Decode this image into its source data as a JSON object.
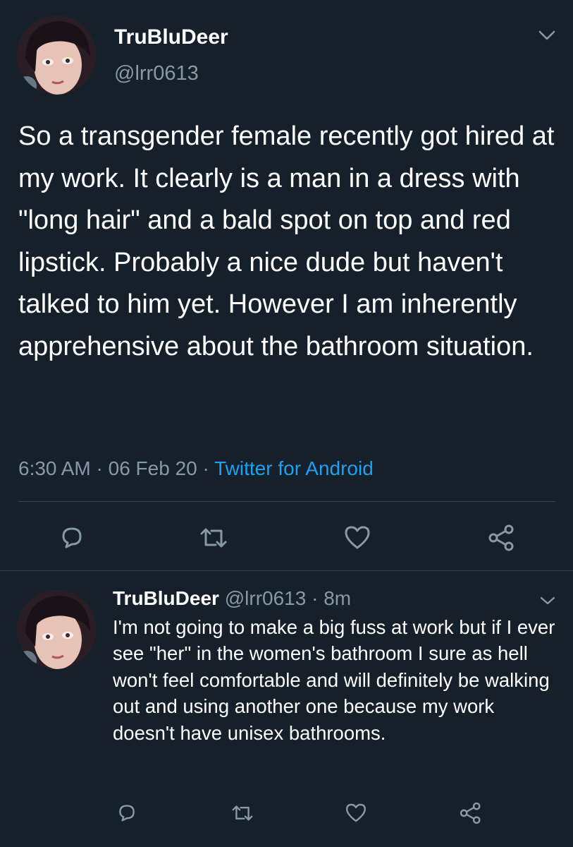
{
  "main_tweet": {
    "display_name": "TruBluDeer",
    "handle": "@lrr0613",
    "text": "So a transgender female recently got hired at my work. It clearly is a man in a dress with \"long hair\" and a bald spot on top and red lipstick. Probably a nice dude but haven't talked to him yet. However I am inherently apprehensive about the bathroom situation.",
    "time": "6:30 AM",
    "sep1": "·",
    "date": "06 Feb 20",
    "sep2": "·",
    "source": "Twitter for Android"
  },
  "reply_tweet": {
    "display_name": "TruBluDeer",
    "handle": "@lrr0613",
    "sep": "·",
    "age": "8m",
    "text": "I'm not going to make a big fuss at work but if I ever see \"her\" in the women's bathroom I sure as hell won't feel comfortable and will definitely be walking out and using another one because my work doesn't have unisex bathrooms."
  },
  "icons": {
    "reply": "reply-icon",
    "retweet": "retweet-icon",
    "like": "like-icon",
    "share": "share-icon",
    "chevron": "chevron-down-icon"
  },
  "colors": {
    "background": "#15202b",
    "text": "#ffffff",
    "muted": "#8899a6",
    "link": "#1da1f2",
    "divider": "#38444d"
  }
}
